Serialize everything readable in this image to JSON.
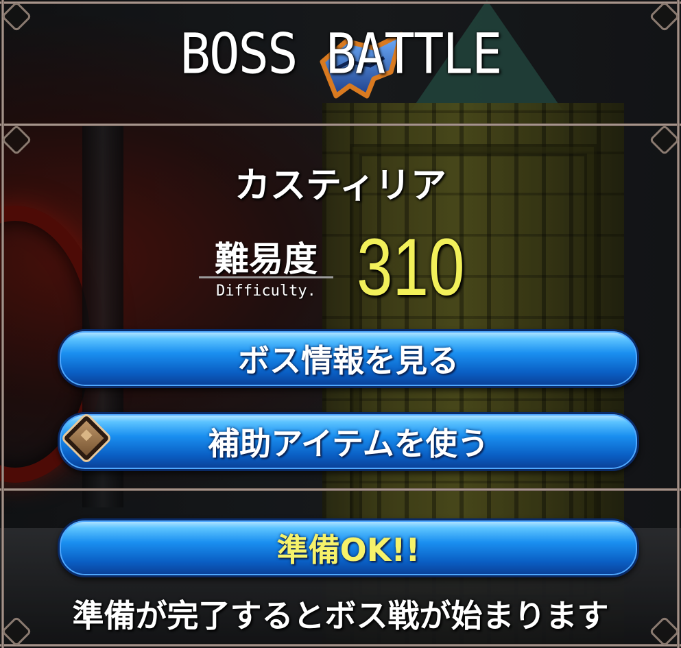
{
  "header": {
    "title": "BOSS BATTLE",
    "emblem_icon": "crown-emblem-icon"
  },
  "boss": {
    "name": "カスティリア"
  },
  "difficulty": {
    "label": "難易度",
    "sublabel": "Difficulty.",
    "value": "310"
  },
  "buttons": {
    "boss_info": "ボス情報を見る",
    "use_item": "補助アイテムを使う",
    "ready": "準備OK!!"
  },
  "footer": {
    "hint": "準備が完了するとボス戦が始まります"
  },
  "colors": {
    "accent_yellow": "#f2f05a",
    "button_blue": "#1a8ff0",
    "frame": "#b9a8a0"
  }
}
